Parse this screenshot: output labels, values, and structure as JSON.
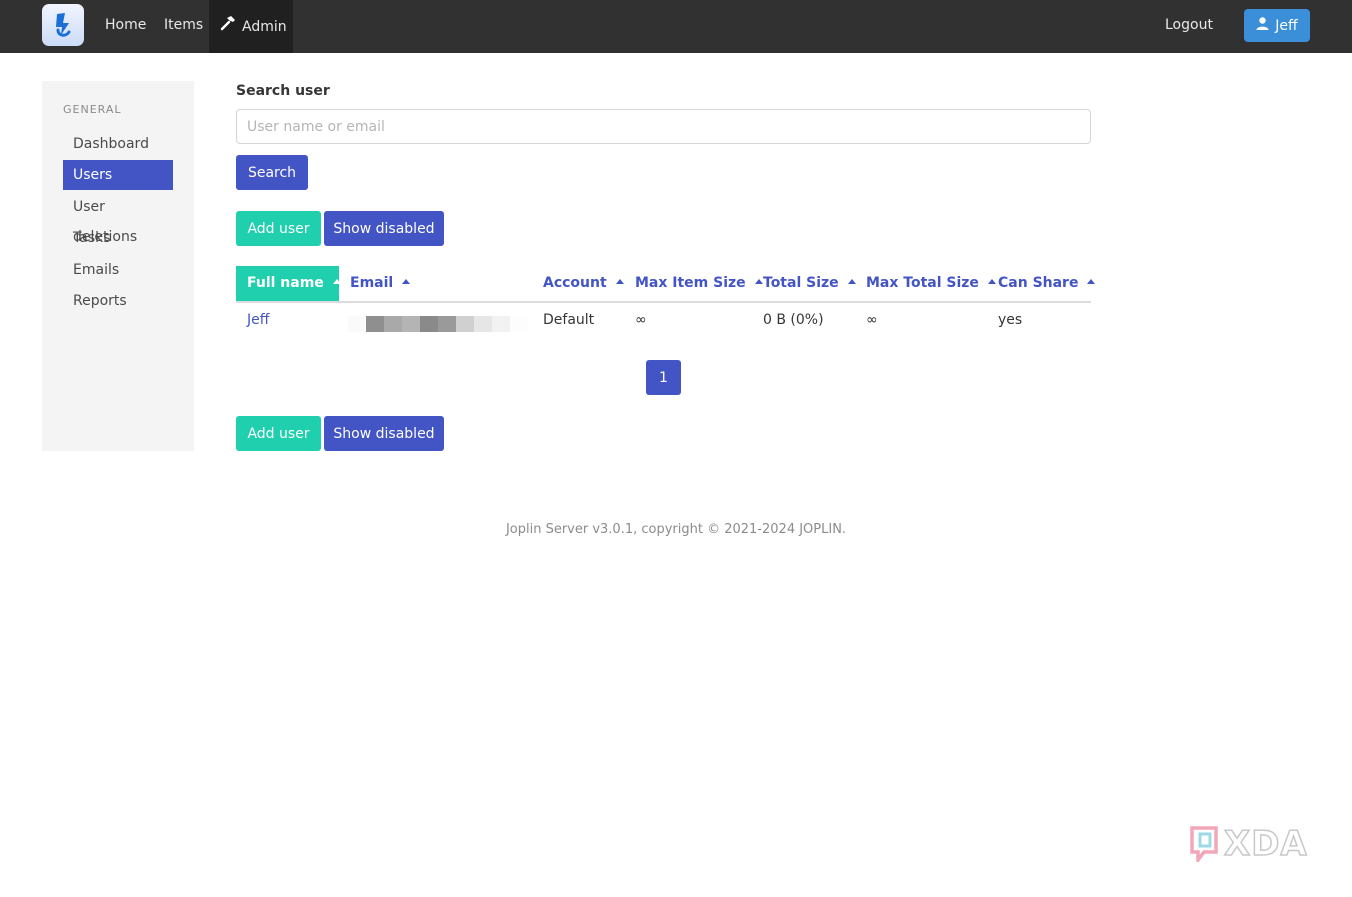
{
  "nav": {
    "home": "Home",
    "items": "Items",
    "admin": "Admin",
    "logout": "Logout",
    "user": "Jeff"
  },
  "sidebar": {
    "heading": "GENERAL",
    "items": [
      {
        "label": "Dashboard",
        "active": false
      },
      {
        "label": "Users",
        "active": true
      },
      {
        "label": "User deletions",
        "active": false
      },
      {
        "label": "Tasks",
        "active": false
      },
      {
        "label": "Emails",
        "active": false
      },
      {
        "label": "Reports",
        "active": false
      }
    ]
  },
  "search": {
    "label": "Search user",
    "placeholder": "User name or email",
    "value": "",
    "button": "Search"
  },
  "actions": {
    "add_user": "Add user",
    "show_disabled": "Show disabled"
  },
  "table": {
    "columns": [
      "Full name",
      "Email",
      "Account",
      "Max Item Size",
      "Total Size",
      "Max Total Size",
      "Can Share"
    ],
    "rows": [
      {
        "full_name": "Jeff",
        "email": "",
        "account": "Default",
        "max_item_size": "∞",
        "total_size": "0 B (0%)",
        "max_total_size": "∞",
        "can_share": "yes"
      }
    ]
  },
  "pagination": {
    "current": "1"
  },
  "footer": "Joplin Server v3.0.1, copyright © 2021-2024 JOPLIN.",
  "watermark": "XDA",
  "colors": {
    "navbar": "#313131",
    "primary": "#4355c4",
    "teal": "#1fcfae",
    "user_button": "#3b8fd9"
  }
}
